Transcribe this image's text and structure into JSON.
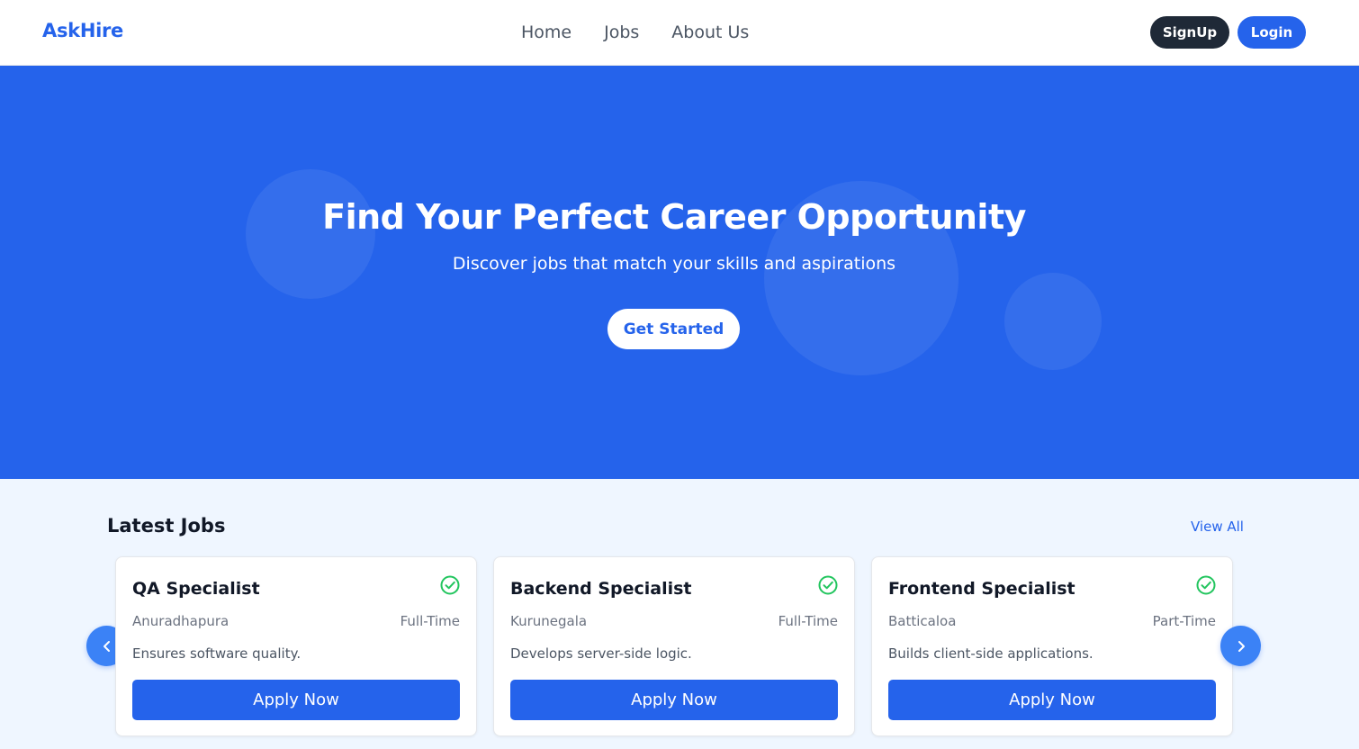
{
  "navbar": {
    "logo": "AskHire",
    "links": [
      "Home",
      "Jobs",
      "About Us"
    ],
    "signup_label": "SignUp",
    "login_label": "Login"
  },
  "hero": {
    "title": "Find Your Perfect Career Opportunity",
    "subtitle": "Discover jobs that match your skills and aspirations",
    "cta_label": "Get Started"
  },
  "latest_jobs": {
    "title": "Latest Jobs",
    "view_all_label": "View All",
    "jobs": [
      {
        "title": "QA Specialist",
        "location": "Anuradhapura",
        "type": "Full-Time",
        "description": "Ensures software quality.",
        "apply_label": "Apply Now"
      },
      {
        "title": "Backend Specialist",
        "location": "Kurunegala",
        "type": "Full-Time",
        "description": "Develops server-side logic.",
        "apply_label": "Apply Now"
      },
      {
        "title": "Frontend Specialist",
        "location": "Batticaloa",
        "type": "Part-Time",
        "description": "Builds client-side applications.",
        "apply_label": "Apply Now"
      }
    ]
  },
  "colors": {
    "primary": "#2563eb",
    "dark": "#1f2937",
    "section_bg": "#eff6ff",
    "check": "#22c55e"
  },
  "icons": {
    "card_status": "check-circle-icon",
    "prev": "chevron-left-icon",
    "next": "chevron-right-icon"
  }
}
